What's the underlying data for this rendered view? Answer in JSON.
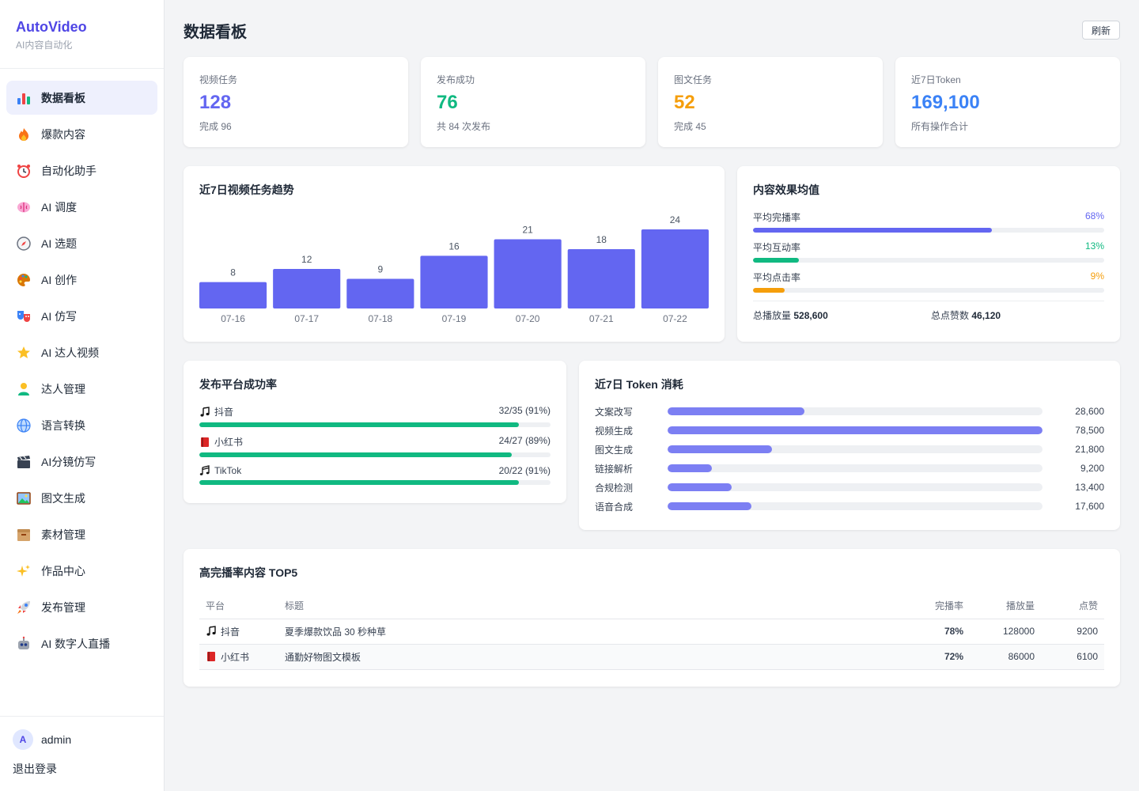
{
  "brand": {
    "name": "AutoVideo",
    "subtitle": "AI内容自动化"
  },
  "sidebar": {
    "items": [
      {
        "label": "数据看板",
        "icon": "bar-chart-icon",
        "active": true
      },
      {
        "label": "爆款内容",
        "icon": "fire-icon"
      },
      {
        "label": "自动化助手",
        "icon": "alarm-clock-icon"
      },
      {
        "label": "AI 调度",
        "icon": "brain-icon"
      },
      {
        "label": "AI 选题",
        "icon": "compass-icon"
      },
      {
        "label": "AI 创作",
        "icon": "palette-icon"
      },
      {
        "label": "AI 仿写",
        "icon": "masks-icon"
      },
      {
        "label": "AI 达人视频",
        "icon": "star-icon"
      },
      {
        "label": "达人管理",
        "icon": "person-icon"
      },
      {
        "label": "语言转换",
        "icon": "globe-icon"
      },
      {
        "label": "AI分镜仿写",
        "icon": "clapper-icon"
      },
      {
        "label": "图文生成",
        "icon": "picture-icon"
      },
      {
        "label": "素材管理",
        "icon": "box-icon"
      },
      {
        "label": "作品中心",
        "icon": "sparkles-icon"
      },
      {
        "label": "发布管理",
        "icon": "rocket-icon"
      },
      {
        "label": "AI 数字人直播",
        "icon": "robot-icon"
      }
    ],
    "user": {
      "initial": "A",
      "name": "admin"
    },
    "logout": "退出登录"
  },
  "header": {
    "title": "数据看板",
    "refresh": "刷新"
  },
  "stats": [
    {
      "label": "视频任务",
      "value": "128",
      "sub": "完成 96",
      "color": "#6366f1"
    },
    {
      "label": "发布成功",
      "value": "76",
      "sub": "共 84 次发布",
      "color": "#10b981"
    },
    {
      "label": "图文任务",
      "value": "52",
      "sub": "完成 45",
      "color": "#f59e0b"
    },
    {
      "label": "近7日Token",
      "value": "169,100",
      "sub": "所有操作合计",
      "color": "#3b82f6"
    }
  ],
  "trend": {
    "title": "近7日视频任务趋势"
  },
  "chart_data": {
    "type": "bar",
    "title": "近7日视频任务趋势",
    "categories": [
      "07-16",
      "07-17",
      "07-18",
      "07-19",
      "07-20",
      "07-21",
      "07-22"
    ],
    "values": [
      8,
      12,
      9,
      16,
      21,
      18,
      24
    ],
    "color": "#6366f1",
    "ylim": [
      0,
      24
    ],
    "grid": false
  },
  "effect": {
    "title": "内容效果均值",
    "metrics": [
      {
        "label": "平均完播率",
        "value": "68%",
        "fraction": 0.68,
        "color": "#6366f1"
      },
      {
        "label": "平均互动率",
        "value": "13%",
        "fraction": 0.13,
        "color": "#10b981"
      },
      {
        "label": "平均点击率",
        "value": "9%",
        "fraction": 0.09,
        "color": "#f59e0b"
      }
    ],
    "total_plays_label": "总播放量",
    "total_plays": "528,600",
    "total_likes_label": "总点赞数",
    "total_likes": "46,120"
  },
  "platform": {
    "title": "发布平台成功率",
    "rows": [
      {
        "name": "抖音",
        "icon": "music-note-icon",
        "value": "32/35 (91%)",
        "fraction": 0.91
      },
      {
        "name": "小红书",
        "icon": "book-icon",
        "value": "24/27 (89%)",
        "fraction": 0.89
      },
      {
        "name": "TikTok",
        "icon": "music-notes-icon",
        "value": "20/22 (91%)",
        "fraction": 0.91
      }
    ],
    "color": "#10b981"
  },
  "token": {
    "title": "近7日 Token 消耗",
    "rows": [
      {
        "label": "文案改写",
        "value": "28,600",
        "amount": 28600
      },
      {
        "label": "视频生成",
        "value": "78,500",
        "amount": 78500
      },
      {
        "label": "图文生成",
        "value": "21,800",
        "amount": 21800
      },
      {
        "label": "链接解析",
        "value": "9,200",
        "amount": 9200
      },
      {
        "label": "合规检测",
        "value": "13,400",
        "amount": 13400
      },
      {
        "label": "语音合成",
        "value": "17,600",
        "amount": 17600
      }
    ],
    "max": 78500
  },
  "top5": {
    "title": "高完播率内容 TOP5",
    "columns": {
      "platform": "平台",
      "title": "标题",
      "rate": "完播率",
      "plays": "播放量",
      "likes": "点赞"
    },
    "rows": [
      {
        "platform": "抖音",
        "icon": "music-note-icon",
        "title": "夏季爆款饮品 30 秒种草",
        "rate": "78%",
        "plays": "128000",
        "likes": "9200"
      },
      {
        "platform": "小红书",
        "icon": "book-icon",
        "title": "通勤好物图文模板",
        "rate": "72%",
        "plays": "86000",
        "likes": "6100"
      }
    ]
  }
}
